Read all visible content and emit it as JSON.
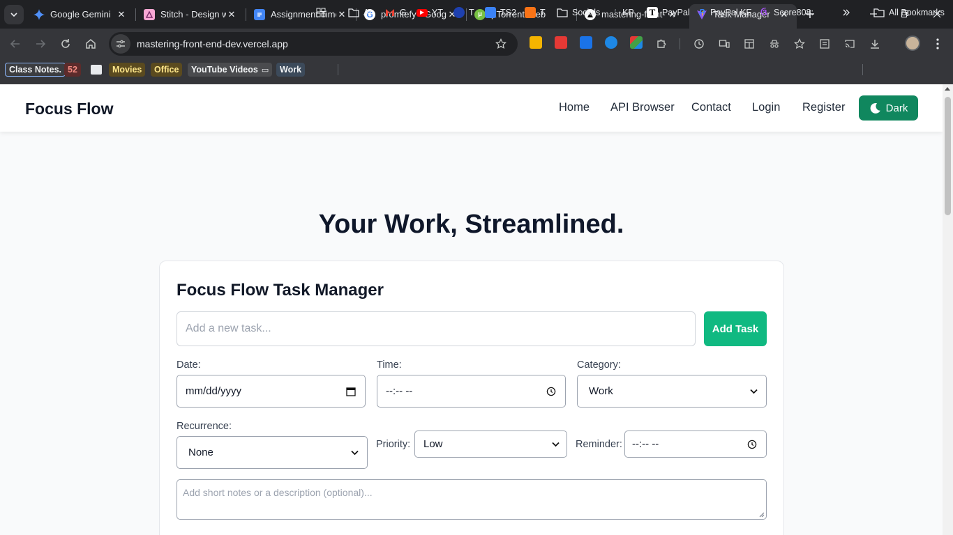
{
  "browser": {
    "tabs": [
      {
        "title": "Google Gemini",
        "icon": "gemini-icon"
      },
      {
        "title": "Stitch - Design w",
        "icon": "stitch-icon"
      },
      {
        "title": "Assignment Time",
        "icon": "docs-icon"
      },
      {
        "title": "promtefy - Goog",
        "icon": "google-icon"
      },
      {
        "title": "µTorrent Web",
        "icon": "utorrent-icon"
      },
      {
        "title": "mastering-front-",
        "icon": "vercel-icon"
      },
      {
        "title": "Task Manager",
        "icon": "vite-icon",
        "active": true
      }
    ],
    "url": "mastering-front-end-dev.vercel.app",
    "bookmarks": [
      {
        "label": "Class Notes.",
        "style": "chip"
      },
      {
        "label": "52",
        "style": "chip"
      },
      {
        "label": "",
        "style": "chip"
      },
      {
        "label": "Movies",
        "style": "chip"
      },
      {
        "label": "Office",
        "style": "chip"
      },
      {
        "label": "YouTube Videos",
        "style": "chip"
      },
      {
        "label": "Work",
        "style": "chip"
      },
      {
        "label": "AI",
        "icon": "folder-icon"
      },
      {
        "label": "G",
        "icon": "gmail-icon"
      },
      {
        "label": "YT",
        "icon": "youtube-icon"
      },
      {
        "label": "T",
        "icon": "t-icon"
      },
      {
        "label": "TS2",
        "icon": "ts2-icon"
      },
      {
        "label": "T",
        "icon": "t2-icon"
      },
      {
        "label": "Socials",
        "icon": "folder-icon"
      },
      {
        "label": "KP",
        "icon": "kp-icon"
      },
      {
        "label": "PayPal",
        "icon": "paypal-t-icon"
      },
      {
        "label": "PayPal KE",
        "icon": "paypal-icon"
      },
      {
        "label": "Score808:",
        "icon": "score-icon"
      },
      {
        "label": "All Bookmarks",
        "icon": "folder-icon"
      }
    ]
  },
  "page": {
    "brand": "Focus Flow",
    "nav": {
      "home": "Home",
      "api": "API Browser",
      "contact": "Contact",
      "login": "Login",
      "register": "Register",
      "theme": "Dark"
    },
    "hero": "Your Work, Streamlined.",
    "card": {
      "title": "Focus Flow Task Manager",
      "task_placeholder": "Add a new task...",
      "add_button": "Add Task",
      "date_label": "Date:",
      "date_value": "mm/dd/yyyy",
      "time_label": "Time:",
      "time_value": "--:-- --",
      "category_label": "Category:",
      "category_value": "Work",
      "recurrence_label": "Recurrence:",
      "recurrence_value": "None",
      "priority_label": "Priority:",
      "priority_value": "Low",
      "reminder_label": "Reminder:",
      "reminder_value": "--:-- --",
      "notes_placeholder": "Add short notes or a description (optional)..."
    }
  },
  "colors": {
    "accent_green": "#10b981",
    "dark_button": "#10875e",
    "chrome_dark": "#202124",
    "chrome_toolbar": "#35363a"
  }
}
